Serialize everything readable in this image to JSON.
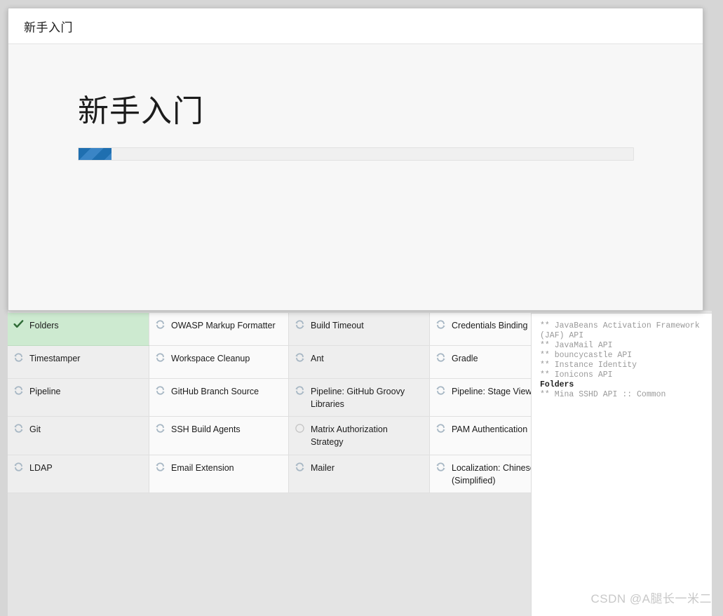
{
  "window": {
    "background_color": "#d6d6d6"
  },
  "modal": {
    "title": "新手入门",
    "heading": "新手入门",
    "progress": {
      "percent": 6,
      "fill_color": "#1f6fb0",
      "track_color": "#f0f0f0"
    }
  },
  "plugins": {
    "columns": [
      {
        "items": [
          {
            "label": "Folders",
            "status": "done"
          },
          {
            "label": "Timestamper",
            "status": "installing"
          },
          {
            "label": "Pipeline",
            "status": "installing"
          },
          {
            "label": "Git",
            "status": "installing"
          },
          {
            "label": "LDAP",
            "status": "installing"
          }
        ]
      },
      {
        "items": [
          {
            "label": "OWASP Markup Formatter",
            "status": "installing"
          },
          {
            "label": "Workspace Cleanup",
            "status": "installing"
          },
          {
            "label": "GitHub Branch Source",
            "status": "installing"
          },
          {
            "label": "SSH Build Agents",
            "status": "installing"
          },
          {
            "label": "Email Extension",
            "status": "installing"
          }
        ]
      },
      {
        "items": [
          {
            "label": "Build Timeout",
            "status": "installing"
          },
          {
            "label": "Ant",
            "status": "installing"
          },
          {
            "label": "Pipeline: GitHub Groovy Libraries",
            "status": "installing"
          },
          {
            "label": "Matrix Authorization Strategy",
            "status": "pending"
          },
          {
            "label": "Mailer",
            "status": "installing"
          }
        ]
      },
      {
        "items": [
          {
            "label": "Credentials Binding",
            "status": "installing"
          },
          {
            "label": "Gradle",
            "status": "installing"
          },
          {
            "label": "Pipeline: Stage View",
            "status": "installing"
          },
          {
            "label": "PAM Authentication",
            "status": "installing"
          },
          {
            "label": "Localization: Chinese (Simplified)",
            "status": "installing"
          }
        ]
      }
    ],
    "status_icons": {
      "done": "check-icon",
      "installing": "refresh-spinner-icon",
      "pending": "empty-circle-icon"
    },
    "status_colors": {
      "done_row_background": "#cdead0",
      "done_check": "#2f6b36",
      "installing_icon": "#a7b7c4",
      "pending_icon": "#c3c3c3"
    }
  },
  "install_log": {
    "lines": [
      {
        "text": "** JavaBeans Activation Framework (JAF) API",
        "current": false
      },
      {
        "text": "** JavaMail API",
        "current": false
      },
      {
        "text": "** bouncycastle API",
        "current": false
      },
      {
        "text": "** Instance Identity",
        "current": false
      },
      {
        "text": "** Ionicons API",
        "current": false
      },
      {
        "text": "Folders",
        "current": true
      },
      {
        "text": "** Mina SSHD API :: Common",
        "current": false
      }
    ]
  },
  "watermark": {
    "text": "CSDN @A腿长一米二"
  }
}
